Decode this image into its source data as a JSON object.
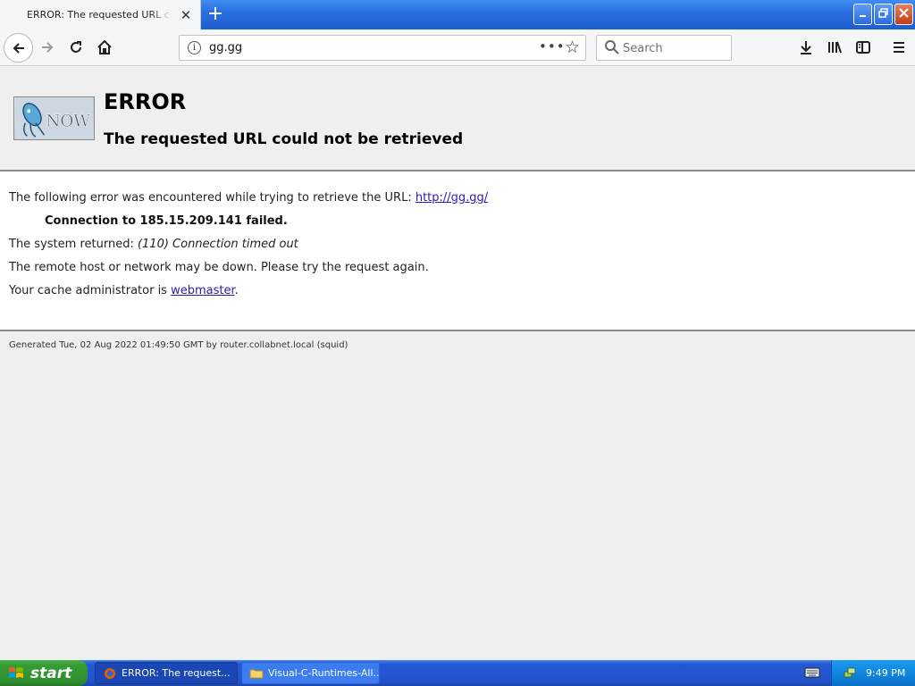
{
  "browser": {
    "tab": {
      "title": "ERROR: The requested URL could not be retrieved",
      "close_glyph": "✕"
    },
    "new_tab_glyph": "+",
    "url": "gg.gg",
    "search": {
      "placeholder": "Search"
    }
  },
  "page": {
    "logo_alt": "Squid NOW",
    "title": "ERROR",
    "subtitle": "The requested URL could not be retrieved",
    "line1_text": "The following error was encountered while trying to retrieve the URL: ",
    "line1_link": "http://gg.gg/",
    "connection_failed": "Connection to 185.15.209.141 failed.",
    "system_returned_label": "The system returned: ",
    "system_returned_value": "(110) Connection timed out",
    "remote_host_text": "The remote host or network may be down. Please try the request again.",
    "cache_admin_text": "Your cache administrator is ",
    "cache_admin_link": "webmaster",
    "cache_admin_suffix": ".",
    "generated": "Generated Tue, 02 Aug 2022 01:49:50 GMT by router.collabnet.local (squid)"
  },
  "taskbar": {
    "start_label": "start",
    "tasks": [
      {
        "label": "ERROR: The request..."
      },
      {
        "label": "Visual-C-Runtimes-All..."
      }
    ],
    "clock": "9:49 PM"
  }
}
